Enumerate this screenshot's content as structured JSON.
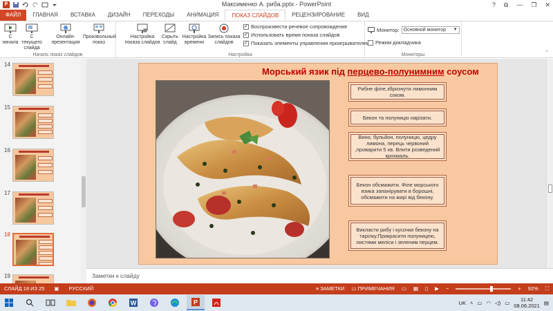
{
  "window": {
    "title": "Максименко А. риба.pptx - PowerPoint",
    "controls": [
      "?",
      "⧉",
      "—",
      "❐",
      "✕"
    ]
  },
  "tabs": [
    {
      "label": "ФАЙЛ"
    },
    {
      "label": "ГЛАВНАЯ"
    },
    {
      "label": "ВСТАВКА"
    },
    {
      "label": "ДИЗАЙН"
    },
    {
      "label": "ПЕРЕХОДЫ"
    },
    {
      "label": "АНИМАЦИЯ"
    },
    {
      "label": "ПОКАЗ СЛАЙДОВ"
    },
    {
      "label": "РЕЦЕНЗИРОВАНИЕ"
    },
    {
      "label": "ВИД"
    }
  ],
  "ribbon": {
    "start_group": {
      "label": "Начать показ слайдов",
      "buttons": [
        "С начала",
        "С текущего слайда",
        "Онлайн-презентация",
        "Произвольный показ"
      ]
    },
    "setup_group": {
      "label": "Настройка",
      "buttons": [
        "Настройка показа слайдов",
        "Скрыть слайд",
        "Настройка времени",
        "Запись показа слайдов"
      ],
      "checkboxes": [
        {
          "label": "Воспроизвести речевое сопровождение",
          "checked": true
        },
        {
          "label": "Использовать время показа слайдов",
          "checked": true
        },
        {
          "label": "Показать элементы управления проигрывателем",
          "checked": true
        }
      ]
    },
    "monitors_group": {
      "label": "Мониторы",
      "monitor_label": "Монитор:",
      "monitor_value": "Основной монитор",
      "presenter_label": "Режим докладчика",
      "presenter_checked": false
    }
  },
  "thumbnails": [
    {
      "num": "14",
      "selected": false
    },
    {
      "num": "15",
      "selected": false
    },
    {
      "num": "16",
      "selected": false
    },
    {
      "num": "17",
      "selected": false
    },
    {
      "num": "18",
      "selected": true
    },
    {
      "num": "19",
      "selected": false
    }
  ],
  "slide": {
    "title_plain": "Морський язик під  ",
    "title_underlined": "перцево-полунимним",
    "title_end": " соусом",
    "steps": [
      "Рибне філе,збризнути  лимонним соком.",
      "Бекон та полуницю нарізати.",
      "Вино, бульйон, полуницю, цедру лимона,  перець червоний ,проварити 5 хв. Влити розведений крохмаль.",
      "Бекон обсмажити. Філе морського язика запанірувати в борошні, обсмажити на жирі від бекону.",
      "Викласти рибу і кусочки бекону на тарілку.Прикрасити полуницею, листями меліси і зеленим перцем."
    ]
  },
  "notes": {
    "placeholder": "Заметки к слайду"
  },
  "status": {
    "slide_info": "СЛАЙД 18 ИЗ 25",
    "language": "РУССКИЙ",
    "notes_btn": "ЗАМЕТКИ",
    "comments_btn": "ПРИМЕЧАНИЯ",
    "zoom": "92%",
    "zoom_level": 0.62
  },
  "taskbar": {
    "apps": [
      "windows-start",
      "search",
      "task-view",
      "file-explorer",
      "firefox",
      "chrome",
      "word",
      "viber",
      "edge",
      "powerpoint",
      "acrobat"
    ],
    "lang": "UK",
    "time": "11:42",
    "date": "08.06.2021"
  },
  "colors": {
    "accent": "#c43e1c",
    "slide_bg": "#f8c9a0",
    "title_red": "#c00000",
    "step_box": "#fbe2cc"
  }
}
